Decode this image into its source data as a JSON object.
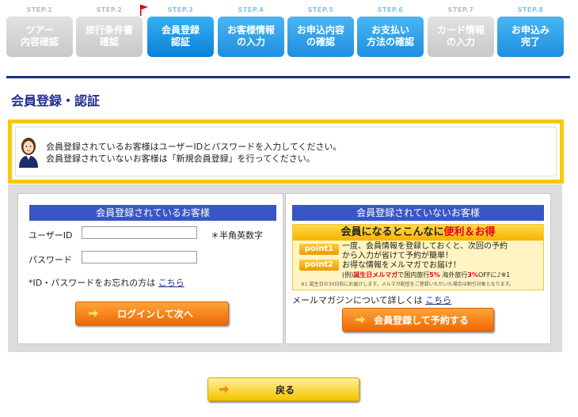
{
  "steps": [
    {
      "num": "STEP.1",
      "label": "ツアー\n内容確認",
      "state": "done"
    },
    {
      "num": "STEP.2",
      "label": "旅行条件書\n確認",
      "state": "done"
    },
    {
      "num": "STEP.3",
      "label": "会員登録\n認証",
      "state": "current"
    },
    {
      "num": "STEP.4",
      "label": "お客様情報\nの入力",
      "state": "todo"
    },
    {
      "num": "STEP.5",
      "label": "お申込内容\nの確認",
      "state": "todo"
    },
    {
      "num": "STEP.6",
      "label": "お支払い\n方法の確認",
      "state": "todo"
    },
    {
      "num": "STEP.7",
      "label": "カード情報\nの入力",
      "state": "inactive"
    },
    {
      "num": "STEP.8",
      "label": "お申込み\n完了",
      "state": "todo"
    }
  ],
  "page_title": "会員登録・認証",
  "notice": {
    "line1": "会員登録されているお客様はユーザーIDとパスワードを入力してください。",
    "line2": "会員登録されていないお客様は「新規会員登録」を行ってください。"
  },
  "member": {
    "heading": "会員登録されているお客様",
    "userid_label": "ユーザーID",
    "userid_value": "",
    "userid_hint": "＊半角英数字",
    "password_label": "パスワード",
    "password_value": "",
    "forgot_text": "*ID・パスワードをお忘れの方は",
    "forgot_link": "こちら",
    "login_button": "ログインして次へ"
  },
  "nonmember": {
    "heading": "会員登録されていないお客様",
    "promo_title_pre": "会員になるとこんなに",
    "promo_title_hl": "便利＆お得",
    "point1_label": "point1",
    "point1_line1": "一度、会員情報を登録しておくと、次回の予約",
    "point1_line2": "から入力が省けて予約が簡単！",
    "point2_label": "point2",
    "point2_line1": "お得な情報をメルマガでお届け！",
    "note_pre": "(例)",
    "note_red1": "誕生日メルマガ",
    "note_mid": "で国内旅行",
    "note_red2": "5%",
    "note_mid2": "海外旅行",
    "note_red3": "3%",
    "note_post": "OFFに♪※1",
    "small_note": "※1 誕生日の30日前にお届けします。メルマガ配信をご登録いただいた場合は割引対象となります。",
    "mail_text": "メールマガジンについて詳しくは",
    "mail_link": "こちら",
    "register_button": "会員登録して予約する"
  },
  "back_button": "戻る",
  "colors": {
    "accent_navy": "#1f2e8c",
    "step_blue": "#1e8fe0",
    "panel_head": "#3856c6",
    "notice_border": "#f9c800",
    "orange_button": "#ee6a05"
  }
}
